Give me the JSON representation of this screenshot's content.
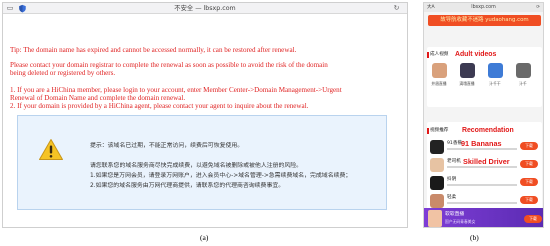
{
  "panel_a": {
    "url": "不安全 — lbsxp.com",
    "lines": [
      "Tip: The domain name has expired and cannot be accessed normally, it can be restored after renewal.",
      "Please contact your domain registrar to complete the renewal as soon as possible to avoid the risk of the domain",
      "being deleted or registered by others.",
      "1. If you are a HiChina member, please login to your account, enter Member Center->Domain Management->Urgent",
      "Renewal of Domain Name and complete the domain renewal.",
      "2. If your domain is provided by a HiChina agent, please contact your agent to inquire about the renewal."
    ],
    "notice": [
      "提示：该域名已过期，不能正常访问，续费后可恢复使用。",
      "请您联系您的域名服务商尽快完成续费，以避免域名被删除或被他人注册的风险。",
      "1.如果您是万网会员，请登录万网账户，进入会员中心->域名管理->急需续费域名，完成域名续费；",
      "2.如果您的域名服务由万网代理商提供，请联系您的代理商咨询续费事宜。"
    ],
    "caption": "(a)"
  },
  "panel_b": {
    "status_left": "大A",
    "url": "lbsxp.com",
    "status_right": "⟳",
    "banner": "故导航收藏不迷路 yudaohang.com",
    "adult_section": {
      "heading": "成人视频",
      "heading_en": "Adult videos"
    },
    "adult_apps": [
      {
        "label": "井眉直播",
        "color": "#d9a17c"
      },
      {
        "label": "滴哦直播",
        "color": "#3c3a52"
      },
      {
        "label": "汁千干",
        "color": "#3e7bd6"
      },
      {
        "label": "汁千",
        "color": "#6a6a6a"
      }
    ],
    "rec_section": {
      "heading": "视频推荐",
      "heading_en": "Recomendation"
    },
    "rec_items": [
      {
        "cn": "91香蕉",
        "en": "91 Bananas",
        "button": "下载",
        "color": "#222222"
      },
      {
        "cn": "老司机",
        "en": "Skilled Driver",
        "button": "下载",
        "color": "#e7c3a3"
      },
      {
        "cn": "抖阴",
        "en": "",
        "button": "下载",
        "color": "#1a1a1a"
      },
      {
        "cn": "轻柔",
        "en": "",
        "button": "下载",
        "color": "#c98a6a"
      }
    ],
    "footer_ad": {
      "title": "软软直播",
      "subtitle": "国产无码青春美女",
      "button": "下载"
    },
    "caption": "(b)"
  }
}
